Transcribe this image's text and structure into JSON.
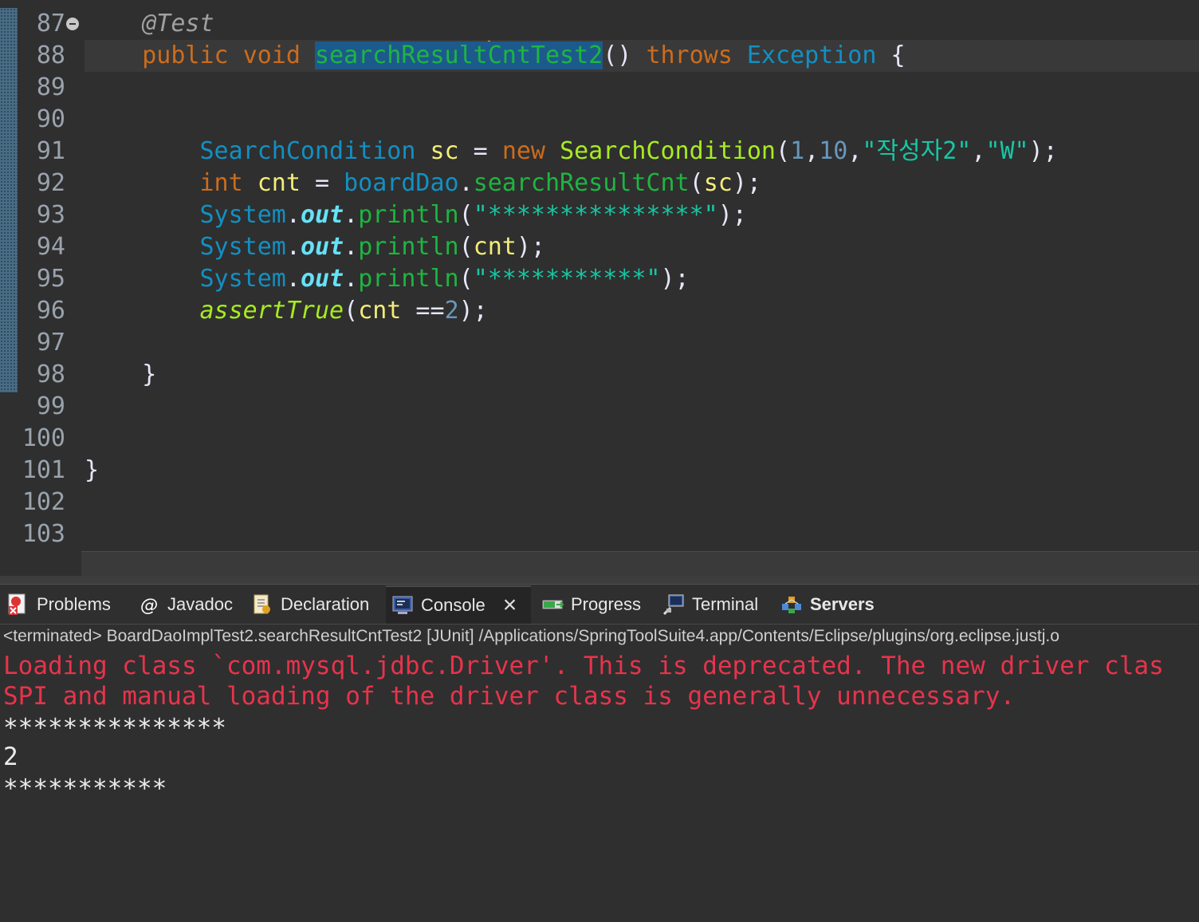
{
  "editor": {
    "lines": [
      {
        "num": "87",
        "fold": true,
        "tokens": [
          {
            "t": "    ",
            "c": ""
          },
          {
            "t": "@Test",
            "c": "an"
          }
        ]
      },
      {
        "num": "88",
        "current": true,
        "tokens": [
          {
            "t": "    ",
            "c": ""
          },
          {
            "t": "public",
            "c": "kw"
          },
          {
            "t": " ",
            "c": ""
          },
          {
            "t": "void",
            "c": "kw"
          },
          {
            "t": " ",
            "c": ""
          },
          {
            "t": "searchResult",
            "c": "sel"
          },
          {
            "t": "|",
            "c": "caret"
          },
          {
            "t": "CntTest2",
            "c": "sel"
          },
          {
            "t": "()",
            "c": "pl"
          },
          {
            "t": " ",
            "c": ""
          },
          {
            "t": "throws",
            "c": "kw"
          },
          {
            "t": " ",
            "c": ""
          },
          {
            "t": "Exception",
            "c": "ty"
          },
          {
            "t": " {",
            "c": "pl"
          }
        ]
      },
      {
        "num": "89",
        "tokens": []
      },
      {
        "num": "90",
        "tokens": []
      },
      {
        "num": "91",
        "tokens": [
          {
            "t": "        ",
            "c": ""
          },
          {
            "t": "SearchCondition",
            "c": "ty"
          },
          {
            "t": " ",
            "c": ""
          },
          {
            "t": "sc",
            "c": "va"
          },
          {
            "t": " = ",
            "c": "pl"
          },
          {
            "t": "new",
            "c": "kw"
          },
          {
            "t": " ",
            "c": ""
          },
          {
            "t": "SearchCondition",
            "c": "fn"
          },
          {
            "t": "(",
            "c": "pl"
          },
          {
            "t": "1",
            "c": "nu"
          },
          {
            "t": ",",
            "c": "pl"
          },
          {
            "t": "10",
            "c": "nu"
          },
          {
            "t": ",",
            "c": "pl"
          },
          {
            "t": "\"작성자2\"",
            "c": "st"
          },
          {
            "t": ",",
            "c": "pl"
          },
          {
            "t": "\"W\"",
            "c": "st"
          },
          {
            "t": ");",
            "c": "pl"
          }
        ]
      },
      {
        "num": "92",
        "tokens": [
          {
            "t": "        ",
            "c": ""
          },
          {
            "t": "int",
            "c": "kw"
          },
          {
            "t": " ",
            "c": ""
          },
          {
            "t": "cnt",
            "c": "va"
          },
          {
            "t": " = ",
            "c": "pl"
          },
          {
            "t": "boardDao",
            "c": "ty"
          },
          {
            "t": ".",
            "c": "pl"
          },
          {
            "t": "searchResultCnt",
            "c": "mt"
          },
          {
            "t": "(",
            "c": "pl"
          },
          {
            "t": "sc",
            "c": "va"
          },
          {
            "t": ");",
            "c": "pl"
          }
        ]
      },
      {
        "num": "93",
        "tokens": [
          {
            "t": "        ",
            "c": ""
          },
          {
            "t": "System",
            "c": "ty"
          },
          {
            "t": ".",
            "c": "pl"
          },
          {
            "t": "out",
            "c": "fld"
          },
          {
            "t": ".",
            "c": "pl"
          },
          {
            "t": "println",
            "c": "mt"
          },
          {
            "t": "(",
            "c": "pl"
          },
          {
            "t": "\"***************\"",
            "c": "st"
          },
          {
            "t": ");",
            "c": "pl"
          }
        ]
      },
      {
        "num": "94",
        "tokens": [
          {
            "t": "        ",
            "c": ""
          },
          {
            "t": "System",
            "c": "ty"
          },
          {
            "t": ".",
            "c": "pl"
          },
          {
            "t": "out",
            "c": "fld"
          },
          {
            "t": ".",
            "c": "pl"
          },
          {
            "t": "println",
            "c": "mt"
          },
          {
            "t": "(",
            "c": "pl"
          },
          {
            "t": "cnt",
            "c": "va"
          },
          {
            "t": ");",
            "c": "pl"
          }
        ]
      },
      {
        "num": "95",
        "tokens": [
          {
            "t": "        ",
            "c": ""
          },
          {
            "t": "System",
            "c": "ty"
          },
          {
            "t": ".",
            "c": "pl"
          },
          {
            "t": "out",
            "c": "fld"
          },
          {
            "t": ".",
            "c": "pl"
          },
          {
            "t": "println",
            "c": "mt"
          },
          {
            "t": "(",
            "c": "pl"
          },
          {
            "t": "\"***********\"",
            "c": "st"
          },
          {
            "t": ");",
            "c": "pl"
          }
        ]
      },
      {
        "num": "96",
        "tokens": [
          {
            "t": "        ",
            "c": ""
          },
          {
            "t": "assertTrue",
            "c": "fn ital"
          },
          {
            "t": "(",
            "c": "pl"
          },
          {
            "t": "cnt",
            "c": "va"
          },
          {
            "t": " ==",
            "c": "pl"
          },
          {
            "t": "2",
            "c": "nu"
          },
          {
            "t": ");",
            "c": "pl"
          }
        ]
      },
      {
        "num": "97",
        "tokens": []
      },
      {
        "num": "98",
        "tokens": [
          {
            "t": "    }",
            "c": "pl"
          }
        ]
      },
      {
        "num": "99",
        "tokens": []
      },
      {
        "num": "100",
        "tokens": []
      },
      {
        "num": "101",
        "tokens": [
          {
            "t": "}",
            "c": "pl"
          }
        ]
      },
      {
        "num": "102",
        "tokens": []
      },
      {
        "num": "103",
        "tokens": []
      }
    ]
  },
  "panel": {
    "tabs": [
      {
        "label": "Problems",
        "icon": "problems-icon"
      },
      {
        "label": "Javadoc",
        "icon": "javadoc-icon"
      },
      {
        "label": "Declaration",
        "icon": "declaration-icon"
      },
      {
        "label": "Console",
        "icon": "console-icon",
        "active": true
      },
      {
        "label": "Progress",
        "icon": "progress-icon"
      },
      {
        "label": "Terminal",
        "icon": "terminal-icon"
      },
      {
        "label": "Servers",
        "icon": "servers-icon"
      }
    ],
    "status": "<terminated> BoardDaoImplTest2.searchResultCntTest2 [JUnit] /Applications/SpringToolSuite4.app/Contents/Eclipse/plugins/org.eclipse.justj.o",
    "console": [
      {
        "text": "Loading class `com.mysql.jdbc.Driver'. This is deprecated. The new driver clas",
        "kind": "err"
      },
      {
        "text": "SPI and manual loading of the driver class is generally unnecessary.",
        "kind": "err"
      },
      {
        "text": "***************",
        "kind": "out"
      },
      {
        "text": "2",
        "kind": "out"
      },
      {
        "text": "***********",
        "kind": "out"
      }
    ]
  },
  "colors": {
    "background": "#2f2f2f",
    "keyword": "#cc6c1d",
    "type": "#1290c3",
    "string": "#17c6a3",
    "error": "#e8334c"
  }
}
